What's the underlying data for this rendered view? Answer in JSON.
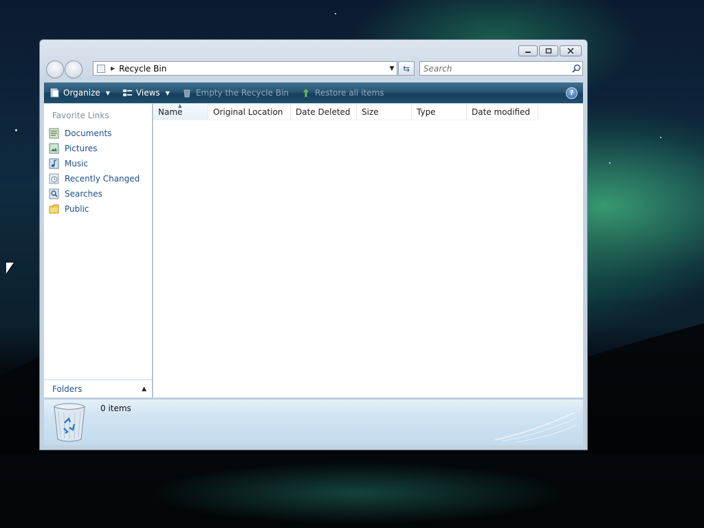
{
  "window": {
    "address": "Recycle Bin",
    "caption_buttons": {
      "minimize": "minimize-icon",
      "maximize": "maximize-icon",
      "close": "close-icon"
    }
  },
  "search": {
    "placeholder": "Search"
  },
  "toolbar": {
    "organize": "Organize",
    "views": "Views",
    "empty": "Empty the Recycle Bin",
    "restore": "Restore all items"
  },
  "nav": {
    "heading": "Favorite Links",
    "items": [
      {
        "label": "Documents",
        "icon": "documents-icon"
      },
      {
        "label": "Pictures",
        "icon": "pictures-icon"
      },
      {
        "label": "Music",
        "icon": "music-icon"
      },
      {
        "label": "Recently Changed",
        "icon": "recently-changed-icon"
      },
      {
        "label": "Searches",
        "icon": "searches-icon"
      },
      {
        "label": "Public",
        "icon": "public-folder-icon"
      }
    ],
    "folders": "Folders"
  },
  "columns": [
    "Name",
    "Original Location",
    "Date Deleted",
    "Size",
    "Type",
    "Date modified"
  ],
  "details": {
    "count": "0 items"
  },
  "colors": {
    "link": "#1b4f8c",
    "toolbar": "#1d4d6b",
    "nav_heading": "#7f8c99"
  }
}
